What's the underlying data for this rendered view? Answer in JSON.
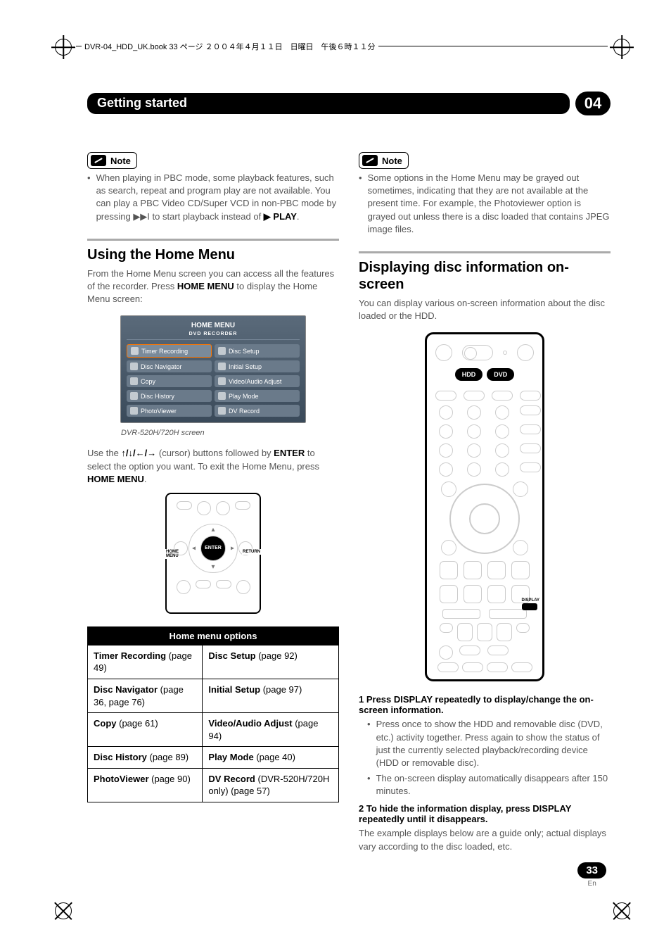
{
  "header": {
    "print_info": "DVR-04_HDD_UK.book 33 ページ ２００４年４月１１日　日曜日　午後６時１１分"
  },
  "banner": {
    "title": "Getting started",
    "num": "04"
  },
  "left": {
    "note_label": "Note",
    "note1": "When playing in PBC mode, some playback features, such as search, repeat and program play are not available. You can play a PBC Video CD/Super VCD in non-PBC mode by pressing ",
    "note1_sym": "▶▶I",
    "note1_b": " to start playback instead of ",
    "note1_play": "▶ PLAY",
    "note1_end": ".",
    "h_home": "Using the Home Menu",
    "p1a": "From the Home Menu screen you can access all the features of the recorder. Press ",
    "p1b": "HOME MENU",
    "p1c": " to display the Home Menu screen:",
    "hm_title": "HOME MENU",
    "hm_sub": "DVD RECORDER",
    "hm": {
      "r1c1": "Timer Recording",
      "r1c2": "Disc Setup",
      "r2c1": "Disc Navigator",
      "r2c2": "Initial Setup",
      "r3c1": "Copy",
      "r3c2": "Video/Audio Adjust",
      "r4c1": "Disc History",
      "r4c2": "Play Mode",
      "r5c1": "PhotoViewer",
      "r5c2": "DV Record"
    },
    "caption": "DVR-520H/720H screen",
    "p2a": "Use the ",
    "p2arrows": "↑/↓/←/→",
    "p2b": " (cursor) buttons followed by ",
    "p2c": "ENTER",
    "p2d": " to select the option you want. To exit the Home Menu, press ",
    "p2e": "HOME MENU",
    "p2f": ".",
    "remote_center": "ENTER",
    "remote_lbl_l": "HOME\nMENU",
    "remote_lbl_r": "RETURN",
    "table": {
      "header": "Home menu options",
      "r1c1a": "Timer Recording",
      "r1c1b": " (page 49)",
      "r1c2a": "Disc Setup",
      "r1c2b": " (page 92)",
      "r2c1a": "Disc Navigator",
      "r2c1b": " (page 36, page 76)",
      "r2c2a": "Initial Setup",
      "r2c2b": " (page 97)",
      "r3c1a": "Copy",
      "r3c1b": " (page 61)",
      "r3c2a": "Video/Audio Adjust",
      "r3c2b": " (page 94)",
      "r4c1a": "Disc History",
      "r4c1b": " (page 89)",
      "r4c2a": "Play Mode",
      "r4c2b": " (page 40)",
      "r5c1a": "PhotoViewer",
      "r5c1b": " (page 90)",
      "r5c2a": "DV Record",
      "r5c2b": " (DVR-520H/720H only) (page 57)"
    }
  },
  "right": {
    "note_label": "Note",
    "note1": "Some options in the Home Menu may be grayed out sometimes, indicating that they are not available at the present time. For example, the Photoviewer option is grayed out unless there is a disc loaded that contains JPEG image files.",
    "h_disp": "Displaying disc information on-screen",
    "p1": "You can display various on-screen information about the disc loaded or the HDD.",
    "hdd": "HDD",
    "dvd": "DVD",
    "display_label": "DISPLAY",
    "step1_head": "1    Press DISPLAY repeatedly to display/change the on-screen information.",
    "step1_b1": "Press once to show the HDD and removable disc (DVD, etc.) activity together. Press again to show the status of just the currently selected playback/recording device (HDD or removable disc).",
    "step1_b2": "The on-screen display automatically disappears after 150 minutes.",
    "step2_head": "2    To hide the information display, press DISPLAY repeatedly until it disappears.",
    "step2_p": "The example displays below are a guide only; actual displays vary according to the disc loaded, etc."
  },
  "footer": {
    "page": "33",
    "lang": "En"
  }
}
